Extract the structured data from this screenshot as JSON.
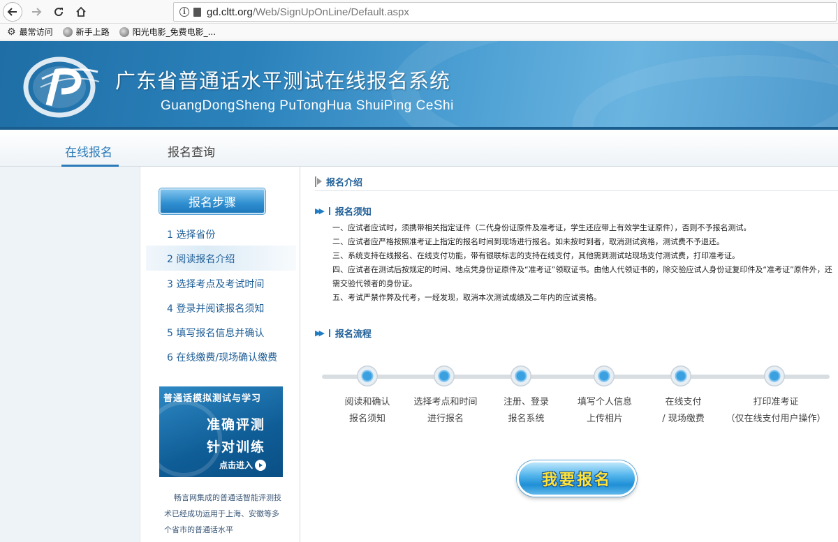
{
  "browser": {
    "url_host": "gd.cltt.org",
    "url_path": "/Web/SignUpOnLine/Default.aspx",
    "bookmarks": [
      {
        "label": "最常访问",
        "icon": "gear-icon"
      },
      {
        "label": "新手上路",
        "icon": "globe-icon"
      },
      {
        "label": "阳光电影_免费电影_...",
        "icon": "globe-icon"
      }
    ]
  },
  "banner": {
    "title": "广东省普通话水平测试在线报名系统",
    "subtitle": "GuangDongSheng PuTongHua ShuiPing CeShi"
  },
  "nav": {
    "tabs": [
      {
        "label": "在线报名",
        "active": true
      },
      {
        "label": "报名查询",
        "active": false
      }
    ]
  },
  "sidebar": {
    "steps_title": "报名步骤",
    "steps": [
      "1 选择省份",
      "2 阅读报名介绍",
      "3 选择考点及考试时间",
      "4 登录并阅读报名须知",
      "5 填写报名信息并确认",
      "6 在线缴费/现场确认缴费"
    ],
    "active_step": 2,
    "ad": {
      "heading": "普通话模拟测试与学习",
      "line1": "准确评测",
      "line2": "针对训练",
      "enter": "点击进入"
    },
    "description": "畅言网集成的普通话智能评测技术已经成功运用于上海、安徽等多个省市的普通话水平"
  },
  "content": {
    "section_title": "报名介绍",
    "notice_title": "报名须知",
    "notice_items": [
      "一、应试者应试时，须携带相关指定证件（二代身份证原件及准考证，学生还应带上有效学生证原件），否则不予报名测试。",
      "二、应试者应严格按照准考证上指定的报名时间到现场进行报名。如未按时到者，取消测试资格，测试费不予退还。",
      "三、系统支持在线报名、在线支付功能，带有银联标志的支持在线支付，其他需到测试站现场支付测试费，打印准考证。",
      "四、应试者在测试后按规定的时间、地点凭身份证原件及“准考证”领取证书。由他人代领证书的，除交验应试人身份证复印件及“准考证”原件外，还需交验代领者的身份证。",
      "五、考试严禁作弊及代考，一经发现，取消本次测试成绩及二年内的应试资格。"
    ],
    "flow_title": "报名流程",
    "flow_steps": [
      {
        "line1": "阅读和确认",
        "line2": "报名须知"
      },
      {
        "line1": "选择考点和时间",
        "line2": "进行报名"
      },
      {
        "line1": "注册、登录",
        "line2": "报名系统"
      },
      {
        "line1": "填写个人信息",
        "line2": "上传相片"
      },
      {
        "line1": "在线支付",
        "line2": "/ 现场缴费"
      },
      {
        "line1": "打印准考证",
        "line2": "（仅在线支付用户操作）"
      }
    ],
    "signup_button": "我要报名"
  }
}
